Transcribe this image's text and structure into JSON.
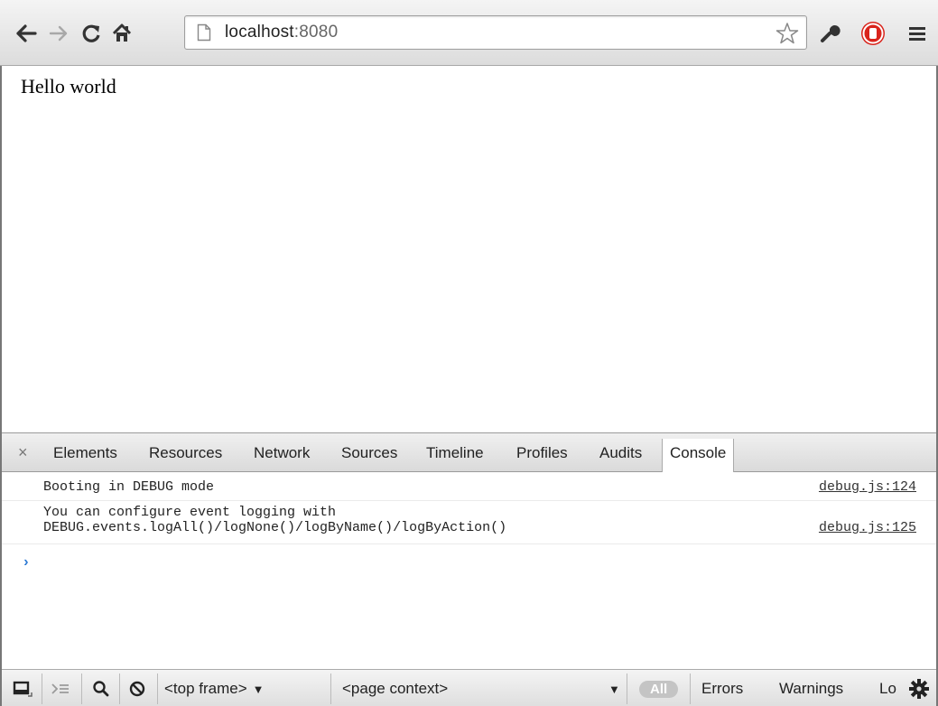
{
  "browser": {
    "url_host": "localhost",
    "url_port": ":8080",
    "icons": [
      "back-icon",
      "forward-icon",
      "reload-icon",
      "home-icon",
      "page-icon",
      "star-icon",
      "wrench-icon",
      "stop-extension-icon",
      "menu-icon"
    ]
  },
  "page": {
    "body_text": "Hello world"
  },
  "devtools": {
    "close_glyph": "×",
    "tabs": [
      "Elements",
      "Resources",
      "Network",
      "Sources",
      "Timeline",
      "Profiles",
      "Audits",
      "Console"
    ],
    "active_tab": "Console",
    "console": {
      "messages": [
        {
          "lines": [
            "Booting in DEBUG mode"
          ],
          "source": "debug.js:124"
        },
        {
          "lines": [
            "You can configure event logging with",
            "DEBUG.events.logAll()/logNone()/logByName()/logByAction()"
          ],
          "source": "debug.js:125"
        }
      ],
      "prompt": "›"
    },
    "statusbar": {
      "frame_select": "<top frame>",
      "context_select": "<page context>",
      "filters": [
        "All",
        "Errors",
        "Warnings",
        "Lo"
      ]
    }
  },
  "colors": {
    "prompt_blue": "#2d7ad4",
    "stop_red": "#d9241c"
  }
}
